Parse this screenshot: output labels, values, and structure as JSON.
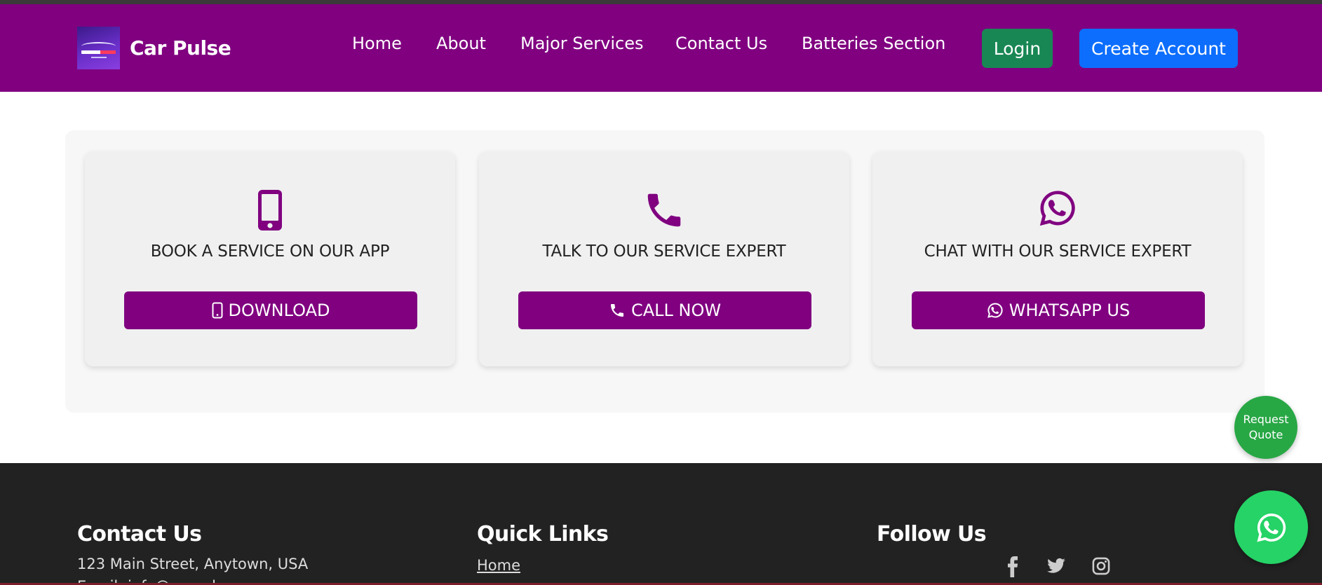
{
  "brand": {
    "name": "Car Pulse"
  },
  "nav": {
    "items": [
      {
        "label": "Home"
      },
      {
        "label": "About"
      },
      {
        "label": "Major Services"
      },
      {
        "label": "Contact Us"
      },
      {
        "label": "Batteries Section"
      }
    ],
    "login_label": "Login",
    "create_label": "Create Account"
  },
  "cards": [
    {
      "title": "BOOK A SERVICE ON OUR APP",
      "button": "DOWNLOAD",
      "icon": "mobile-phone-icon"
    },
    {
      "title": "TALK TO OUR SERVICE EXPERT",
      "button": "CALL NOW",
      "icon": "phone-icon"
    },
    {
      "title": "CHAT WITH OUR SERVICE EXPERT",
      "button": "WHATSAPP US",
      "icon": "whatsapp-icon"
    }
  ],
  "request_quote": {
    "line1": "Request",
    "line2": "Quote"
  },
  "footer": {
    "contact_heading": "Contact Us",
    "address": "123 Main Street, Anytown, USA",
    "email_partial": "Email: info@carpulse.com",
    "links_heading": "Quick Links",
    "links": [
      {
        "label": "Home"
      }
    ],
    "follow_heading": "Follow Us",
    "social": [
      "facebook-icon",
      "twitter-icon",
      "instagram-icon"
    ]
  },
  "colors": {
    "header": "#800080",
    "accent": "#800080",
    "login": "#198754",
    "create": "#0d6efd",
    "quote": "#28a745",
    "whatsapp": "#25d366",
    "footer": "#222222"
  }
}
